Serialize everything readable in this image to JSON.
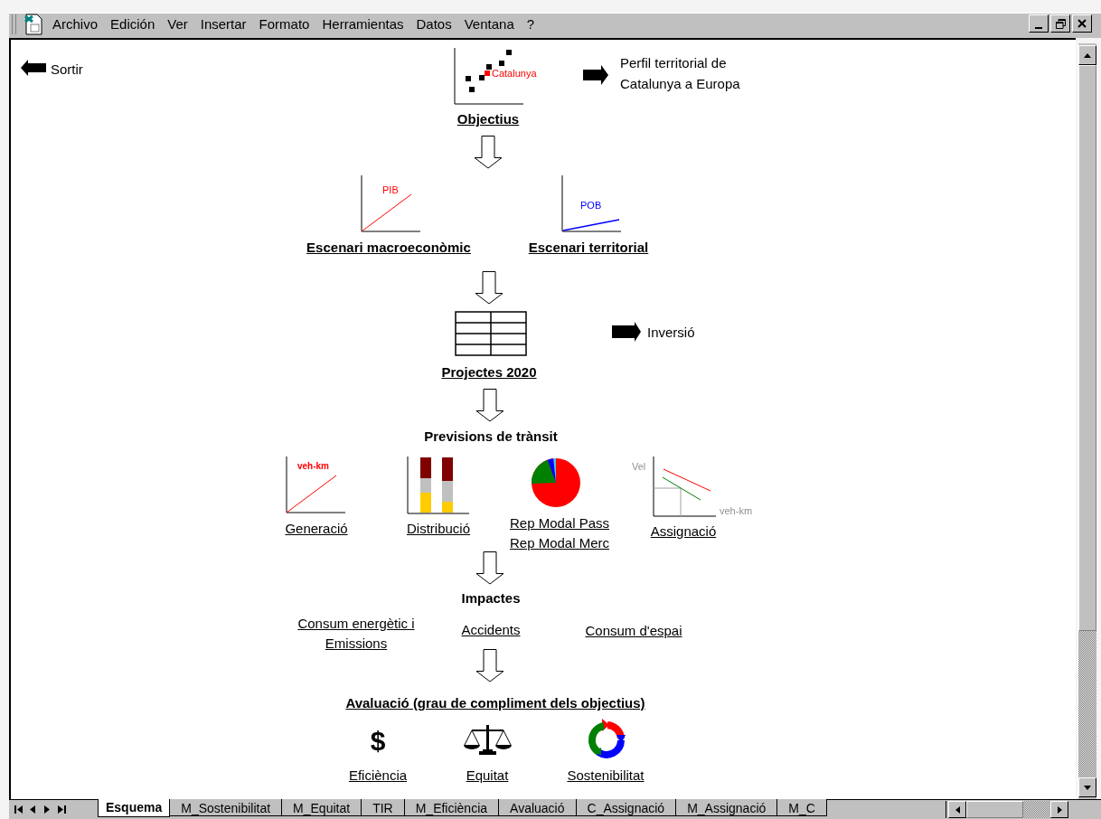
{
  "menu": [
    {
      "label": "Archivo"
    },
    {
      "label": "Edición"
    },
    {
      "label": "Ver"
    },
    {
      "label": "Insertar"
    },
    {
      "label": "Formato"
    },
    {
      "label": "Herramientas"
    },
    {
      "label": "Datos"
    },
    {
      "label": "Ventana"
    },
    {
      "label": "?"
    }
  ],
  "sheet": {
    "exit_link": "Sortir",
    "objectives": {
      "chart_label": "Catalunya",
      "title": "Objectius"
    },
    "profile_link": "Perfil territorial de Catalunya a Europa",
    "scenarios": [
      {
        "chart_label": "PIB",
        "title": "Escenari macroeconòmic"
      },
      {
        "chart_label": "POB",
        "title": "Escenari territorial"
      }
    ],
    "projects": {
      "title": "Projectes 2020"
    },
    "investment_link": "Inversió",
    "traffic": {
      "title": "Previsions de trànsit",
      "steps": [
        {
          "kind": "line",
          "chart_label": "veh-km",
          "links": [
            "Generació"
          ]
        },
        {
          "kind": "bars",
          "links": [
            "Distribució"
          ]
        },
        {
          "kind": "pie",
          "links": [
            "Rep Modal Pass",
            "Rep Modal Merc"
          ]
        },
        {
          "kind": "assignment",
          "y_label": "Vel",
          "x_label": "veh-km",
          "links": [
            "Assignació"
          ]
        }
      ]
    },
    "impacts": {
      "title": "Impactes",
      "links": [
        "Consum energètic i Emissions",
        "Accidents",
        "Consum d'espai"
      ]
    },
    "evaluation": {
      "title": "Avaluació (grau de compliment dels objectius)",
      "criteria": [
        {
          "kind": "symbol",
          "symbol": "$",
          "label": "Eficiència"
        },
        {
          "kind": "scales",
          "label": "Equitat"
        },
        {
          "kind": "cycle",
          "label": "Sostenibilitat"
        }
      ]
    }
  },
  "sheet_tabs": [
    {
      "label": "Esquema",
      "selected": true
    },
    {
      "label": "M_Sostenibilitat",
      "selected": false
    },
    {
      "label": "M_Equitat",
      "selected": false
    },
    {
      "label": "TIR",
      "selected": false
    },
    {
      "label": "M_Eficiència",
      "selected": false
    },
    {
      "label": "Avaluació",
      "selected": false
    },
    {
      "label": "C_Assignació",
      "selected": false
    },
    {
      "label": "M_Assignació",
      "selected": false
    },
    {
      "label": "M_C",
      "selected": false
    }
  ]
}
